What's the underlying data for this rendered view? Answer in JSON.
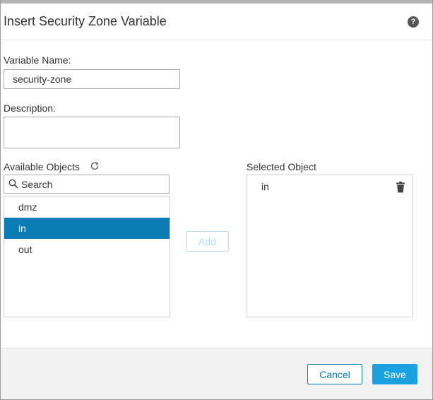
{
  "dialog": {
    "title": "Insert Security Zone Variable",
    "help_icon": "question-circle-icon"
  },
  "form": {
    "variable_name_label": "Variable Name:",
    "variable_name_value": "security-zone",
    "description_label": "Description:",
    "description_value": ""
  },
  "available": {
    "label": "Available Objects",
    "refresh_icon": "refresh-icon",
    "search_placeholder": "Search",
    "search_icon": "search-icon",
    "items": [
      {
        "label": "dmz",
        "selected": false
      },
      {
        "label": "in",
        "selected": true
      },
      {
        "label": "out",
        "selected": false
      }
    ]
  },
  "add_button_label": "Add",
  "selected": {
    "label": "Selected Object",
    "items": [
      {
        "label": "in"
      }
    ],
    "delete_icon": "trash-icon"
  },
  "footer": {
    "cancel_label": "Cancel",
    "save_label": "Save"
  },
  "colors": {
    "accent": "#0b7cb5",
    "save_button": "#1ba0e1"
  }
}
